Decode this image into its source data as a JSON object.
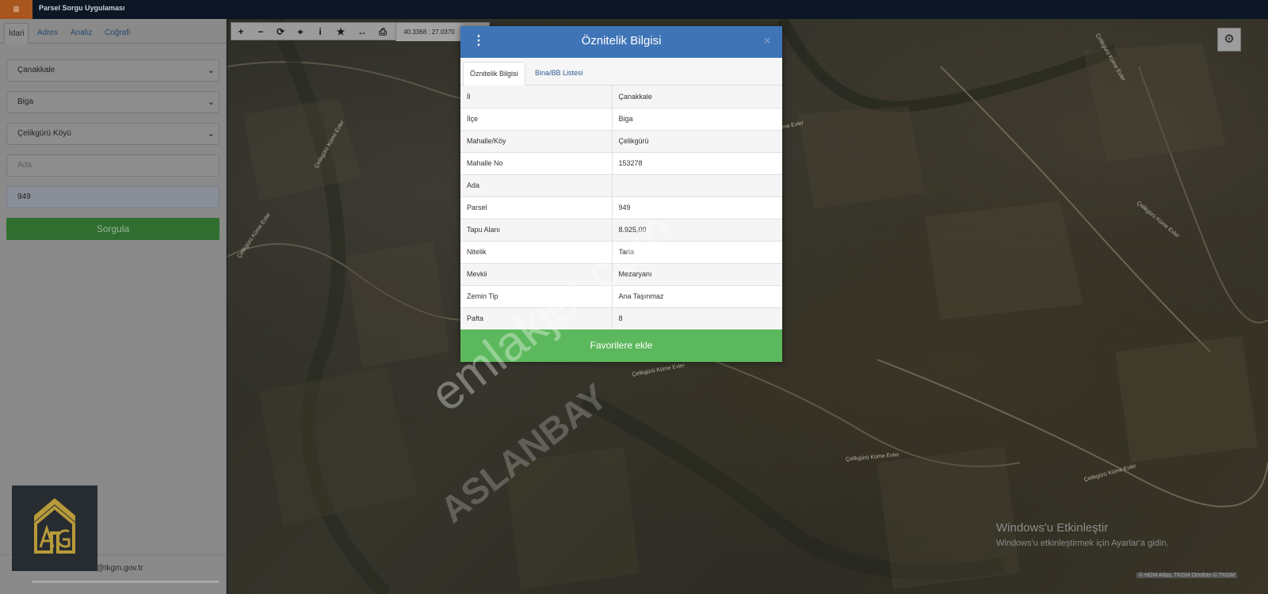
{
  "app": {
    "title": "Parsel Sorgu Uygulaması",
    "menu_icon": "hamburger-icon"
  },
  "sidebar": {
    "tabs": [
      "İdari",
      "Adres",
      "Analiz",
      "Coğrafi"
    ],
    "active_tab": "İdari",
    "province": "Çanakkale",
    "district": "Biga",
    "village": "Çelikgürü Köyü",
    "ada_placeholder": "Ada",
    "parsel_value": "949",
    "query_button": "Sorgula",
    "email": "cbs@tkgm.gov.tr"
  },
  "map": {
    "toolbar": {
      "zoom_in": "+",
      "zoom_out": "−",
      "refresh": "⟳",
      "locate": "⌖",
      "info": "i",
      "favorite": "★",
      "measure": "↔",
      "print": "⎙",
      "coordinates": "40.3368 : 27.0370"
    },
    "settings_icon": "gear-icon",
    "road_labels": [
      "Çelikgürü Küme Evler",
      "Çelikgürü Küme Evler",
      "Çelikgürü Küme Evler",
      "Çelikgürü Küme Evler",
      "Çelikgürü Küme Evler",
      "Çelikgürü Küme Evler",
      "Çelikgürü Küme Evler",
      "Çelikgürü Küme Evler"
    ],
    "windows_line1": "Windows'u Etkinleştir",
    "windows_line2": "Windows'u etkinleştirmek için Ayarlar'a gidin.",
    "attribution": "© HGM Atlas, TKGM Ortofoto © TKGM"
  },
  "dialog": {
    "title": "Öznitelik Bilgisi",
    "close": "×",
    "tabs": [
      "Öznitelik Bilgisi",
      "Bina/BB Listesi"
    ],
    "rows": [
      {
        "key": "İl",
        "value": "Çanakkale"
      },
      {
        "key": "İlçe",
        "value": "Biga"
      },
      {
        "key": "Mahalle/Köy",
        "value": "Çelikgürü"
      },
      {
        "key": "Mahalle No",
        "value": "153278"
      },
      {
        "key": "Ada",
        "value": ""
      },
      {
        "key": "Parsel",
        "value": "949"
      },
      {
        "key": "Tapu Alanı",
        "value": "8.925,00"
      },
      {
        "key": "Nitelik",
        "value": "Tarla"
      },
      {
        "key": "Mevkii",
        "value": "Mezaryanı"
      },
      {
        "key": "Zemin Tip",
        "value": "Ana Taşınmaz"
      },
      {
        "key": "Pafta",
        "value": "8"
      }
    ],
    "favorite_button": "Favorilere ekle"
  },
  "watermark": {
    "line1": "emlakjet.com",
    "line2": "ASLANBAY"
  },
  "colors": {
    "header_blue": "#3f74b7",
    "button_green": "#5cb85c",
    "menu_orange": "#a8561e"
  }
}
